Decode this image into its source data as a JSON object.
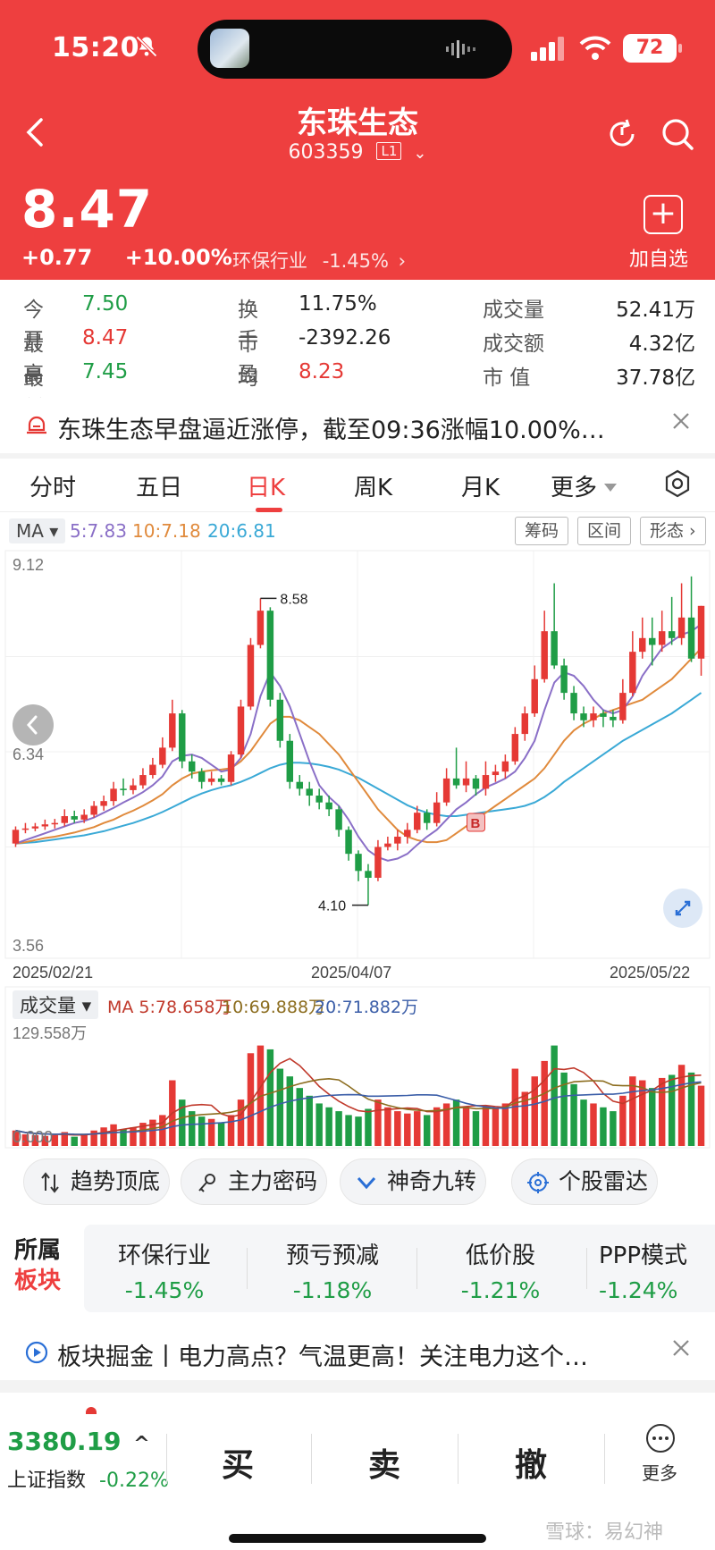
{
  "status_bar": {
    "time": "15:20",
    "battery": "72"
  },
  "header": {
    "stock_name": "东珠生态",
    "stock_code": "603359",
    "level": "L1",
    "price": "8.47",
    "change": "+0.77",
    "change_pct": "+10.00%",
    "industry": "环保行业",
    "industry_change": "-1.45%",
    "industry_chevron": "›",
    "add_plus": "+",
    "add_label": "加自选"
  },
  "stats": [
    {
      "label": "今开",
      "value": "7.50",
      "color": "green"
    },
    {
      "label": "最高",
      "value": "8.47",
      "color": "red"
    },
    {
      "label": "最低",
      "value": "7.45",
      "color": "green"
    },
    {
      "label": "换手",
      "value": "11.75%",
      "color": "black"
    },
    {
      "label": "市盈",
      "value": "-2392.26",
      "color": "black"
    },
    {
      "label": "均价",
      "value": "8.23",
      "color": "red"
    },
    {
      "label": "成交量",
      "value": "52.41万",
      "color": "black"
    },
    {
      "label": "成交额",
      "value": "4.32亿",
      "color": "black"
    },
    {
      "label": "市 值",
      "value": "37.78亿",
      "color": "black"
    }
  ],
  "news": {
    "text": "东珠生态早盘逼近涨停，截至09:36涨幅10.00%…"
  },
  "tabs": [
    "分时",
    "五日",
    "日K",
    "周K",
    "月K",
    "更多"
  ],
  "active_tab": "日K",
  "ma_row": {
    "selector": "MA",
    "ma5": "5:7.83",
    "ma10": "10:7.18",
    "ma20": "20:6.81",
    "buttons": [
      "筹码",
      "区间",
      "形态 ›"
    ]
  },
  "colors": {
    "up": "#e53935",
    "down": "#1f9d46",
    "header_bg": "#ee3f3f",
    "ma5": "#8a6fc7",
    "ma10": "#e08a3c",
    "ma20": "#3aa9d6"
  },
  "chart_data": {
    "type": "candlestick",
    "price_axis": {
      "max_label": "9.12",
      "mid_label": "6.34",
      "min_label": "3.56",
      "ylim": [
        3.56,
        9.12
      ]
    },
    "x_labels": [
      "2025/02/21",
      "2025/04/07",
      "2025/05/22"
    ],
    "annotations": {
      "high_label": "8.58",
      "low_label": "4.10",
      "buy_marker": "B"
    },
    "ohlc": [
      [
        5.0,
        5.2,
        5.25,
        4.95
      ],
      [
        5.2,
        5.22,
        5.3,
        5.15
      ],
      [
        5.22,
        5.25,
        5.3,
        5.18
      ],
      [
        5.25,
        5.28,
        5.35,
        5.2
      ],
      [
        5.28,
        5.3,
        5.36,
        5.22
      ],
      [
        5.3,
        5.4,
        5.5,
        5.25
      ],
      [
        5.4,
        5.35,
        5.48,
        5.3
      ],
      [
        5.35,
        5.42,
        5.5,
        5.3
      ],
      [
        5.42,
        5.55,
        5.62,
        5.38
      ],
      [
        5.55,
        5.62,
        5.7,
        5.48
      ],
      [
        5.62,
        5.8,
        5.9,
        5.55
      ],
      [
        5.8,
        5.78,
        5.95,
        5.7
      ],
      [
        5.78,
        5.85,
        5.95,
        5.72
      ],
      [
        5.85,
        6.0,
        6.1,
        5.8
      ],
      [
        6.0,
        6.15,
        6.25,
        5.95
      ],
      [
        6.15,
        6.4,
        6.55,
        6.1
      ],
      [
        6.4,
        6.9,
        7.1,
        6.35
      ],
      [
        6.9,
        6.2,
        6.95,
        6.1
      ],
      [
        6.2,
        6.05,
        6.3,
        5.95
      ],
      [
        6.05,
        5.9,
        6.1,
        5.8
      ],
      [
        5.9,
        5.95,
        6.05,
        5.85
      ],
      [
        5.95,
        5.9,
        6.0,
        5.85
      ],
      [
        5.9,
        6.3,
        6.35,
        5.85
      ],
      [
        6.3,
        7.0,
        7.1,
        6.25
      ],
      [
        7.0,
        7.9,
        8.0,
        6.95
      ],
      [
        7.9,
        8.4,
        8.58,
        7.85
      ],
      [
        8.4,
        7.1,
        8.45,
        7.0
      ],
      [
        7.1,
        6.5,
        7.2,
        6.4
      ],
      [
        6.5,
        5.9,
        6.6,
        5.8
      ],
      [
        5.9,
        5.8,
        6.0,
        5.7
      ],
      [
        5.8,
        5.7,
        5.9,
        5.55
      ],
      [
        5.7,
        5.6,
        5.8,
        5.5
      ],
      [
        5.6,
        5.5,
        5.7,
        5.4
      ],
      [
        5.5,
        5.2,
        5.55,
        5.1
      ],
      [
        5.2,
        4.85,
        5.25,
        4.75
      ],
      [
        4.85,
        4.6,
        4.9,
        4.45
      ],
      [
        4.6,
        4.5,
        4.7,
        4.1
      ],
      [
        4.5,
        4.95,
        5.05,
        4.45
      ],
      [
        4.95,
        5.0,
        5.1,
        4.9
      ],
      [
        5.0,
        5.1,
        5.2,
        4.9
      ],
      [
        5.1,
        5.2,
        5.3,
        5.0
      ],
      [
        5.2,
        5.45,
        5.55,
        5.15
      ],
      [
        5.45,
        5.3,
        5.5,
        5.2
      ],
      [
        5.3,
        5.6,
        5.75,
        5.25
      ],
      [
        5.6,
        5.95,
        6.1,
        5.55
      ],
      [
        5.95,
        5.85,
        6.4,
        5.8
      ],
      [
        5.85,
        5.95,
        6.2,
        5.75
      ],
      [
        5.95,
        5.8,
        6.0,
        5.7
      ],
      [
        5.8,
        6.0,
        6.2,
        5.7
      ],
      [
        6.0,
        6.05,
        6.15,
        5.9
      ],
      [
        6.05,
        6.2,
        6.3,
        5.95
      ],
      [
        6.2,
        6.6,
        6.7,
        6.15
      ],
      [
        6.6,
        6.9,
        7.0,
        6.5
      ],
      [
        6.9,
        7.4,
        7.6,
        6.85
      ],
      [
        7.4,
        8.1,
        8.4,
        7.35
      ],
      [
        8.1,
        7.6,
        8.8,
        7.55
      ],
      [
        7.6,
        7.2,
        7.7,
        7.1
      ],
      [
        7.2,
        6.9,
        7.3,
        6.8
      ],
      [
        6.9,
        6.8,
        7.0,
        6.7
      ],
      [
        6.8,
        6.9,
        7.0,
        6.7
      ],
      [
        6.9,
        6.85,
        6.95,
        6.7
      ],
      [
        6.85,
        6.8,
        6.95,
        6.7
      ],
      [
        6.8,
        7.2,
        7.4,
        6.75
      ],
      [
        7.2,
        7.8,
        8.1,
        7.15
      ],
      [
        7.8,
        8.0,
        8.3,
        7.7
      ],
      [
        8.0,
        7.9,
        8.3,
        7.6
      ],
      [
        7.9,
        8.1,
        8.4,
        7.8
      ],
      [
        8.1,
        8.0,
        8.6,
        7.9
      ],
      [
        8.0,
        8.3,
        8.8,
        7.9
      ],
      [
        8.3,
        7.7,
        8.9,
        7.65
      ],
      [
        7.7,
        8.47,
        8.47,
        7.45
      ]
    ],
    "ma5": [
      5.0,
      5.05,
      5.1,
      5.15,
      5.2,
      5.25,
      5.3,
      5.33,
      5.38,
      5.45,
      5.52,
      5.6,
      5.67,
      5.75,
      5.85,
      5.98,
      6.2,
      6.28,
      6.3,
      6.25,
      6.15,
      6.05,
      6.08,
      6.25,
      6.6,
      7.15,
      7.5,
      7.3,
      7.0,
      6.6,
      6.2,
      5.85,
      5.68,
      5.55,
      5.35,
      5.1,
      4.9,
      4.8,
      4.75,
      4.78,
      4.85,
      4.98,
      5.1,
      5.2,
      5.35,
      5.5,
      5.6,
      5.72,
      5.82,
      5.88,
      5.95,
      6.05,
      6.25,
      6.5,
      6.95,
      7.35,
      7.5,
      7.45,
      7.3,
      7.1,
      6.95,
      6.9,
      6.95,
      7.15,
      7.45,
      7.65,
      7.85,
      7.95,
      8.05,
      8.1,
      8.2
    ],
    "ma10": [
      5.0,
      5.02,
      5.05,
      5.08,
      5.1,
      5.13,
      5.16,
      5.2,
      5.24,
      5.3,
      5.35,
      5.42,
      5.48,
      5.55,
      5.63,
      5.72,
      5.85,
      5.95,
      6.02,
      6.05,
      6.07,
      6.08,
      6.1,
      6.2,
      6.35,
      6.55,
      6.75,
      6.85,
      6.85,
      6.8,
      6.7,
      6.6,
      6.45,
      6.3,
      6.1,
      5.9,
      5.7,
      5.5,
      5.35,
      5.2,
      5.1,
      5.05,
      5.02,
      5.02,
      5.05,
      5.15,
      5.25,
      5.35,
      5.45,
      5.55,
      5.65,
      5.75,
      5.85,
      5.95,
      6.1,
      6.3,
      6.5,
      6.65,
      6.75,
      6.82,
      6.9,
      6.95,
      7.0,
      7.05,
      7.1,
      7.2,
      7.3,
      7.4,
      7.55,
      7.7,
      7.85
    ],
    "ma20": [
      5.0,
      5.01,
      5.02,
      5.04,
      5.06,
      5.08,
      5.1,
      5.12,
      5.15,
      5.18,
      5.22,
      5.26,
      5.3,
      5.35,
      5.4,
      5.46,
      5.53,
      5.6,
      5.67,
      5.73,
      5.78,
      5.82,
      5.85,
      5.9,
      5.96,
      6.03,
      6.1,
      6.15,
      6.18,
      6.18,
      6.17,
      6.15,
      6.12,
      6.08,
      6.02,
      5.96,
      5.88,
      5.8,
      5.72,
      5.64,
      5.56,
      5.5,
      5.45,
      5.42,
      5.4,
      5.4,
      5.42,
      5.44,
      5.46,
      5.48,
      5.5,
      5.52,
      5.55,
      5.6,
      5.68,
      5.78,
      5.9,
      6.0,
      6.1,
      6.2,
      6.3,
      6.4,
      6.5,
      6.58,
      6.66,
      6.74,
      6.82,
      6.9,
      7.0,
      7.1,
      7.2
    ],
    "volume_panel": {
      "label": "成交量",
      "ma5": "MA 5:78.658万",
      "ma10": "10:69.888万",
      "ma20": "20:71.882万",
      "max_label": "129.558万",
      "min_label": "0.000",
      "ylim": [
        0,
        129.558
      ],
      "volumes": [
        20,
        15,
        14,
        13,
        14,
        18,
        12,
        14,
        20,
        24,
        28,
        22,
        24,
        30,
        34,
        40,
        85,
        60,
        45,
        38,
        35,
        30,
        40,
        60,
        120,
        130,
        125,
        100,
        90,
        75,
        65,
        55,
        50,
        45,
        40,
        38,
        48,
        60,
        50,
        45,
        42,
        45,
        40,
        50,
        55,
        60,
        50,
        45,
        52,
        48,
        55,
        100,
        70,
        90,
        110,
        130,
        95,
        80,
        60,
        55,
        50,
        45,
        65,
        90,
        85,
        75,
        88,
        92,
        105,
        95,
        78
      ]
    }
  },
  "features": [
    "趋势顶底",
    "主力密码",
    "神奇九转",
    "个股雷达"
  ],
  "sectors": {
    "heading_line1": "所属",
    "heading_line2": "板块",
    "items": [
      {
        "name": "环保行业",
        "change": "-1.45%"
      },
      {
        "name": "预亏预减",
        "change": "-1.18%"
      },
      {
        "name": "低价股",
        "change": "-1.21%"
      },
      {
        "name": "PPP模式",
        "change": "-1.24%"
      }
    ]
  },
  "news2": {
    "text": "板块掘金丨电力高点？气温更高！关注电力这个…"
  },
  "bottom": {
    "index_value": "3380.19",
    "index_arrow": "^",
    "index_name": "上证指数",
    "index_change": "-0.22%",
    "buy": "买",
    "sell": "卖",
    "cancel": "撤",
    "more": "更多"
  },
  "watermark": "雪球：易幻神"
}
